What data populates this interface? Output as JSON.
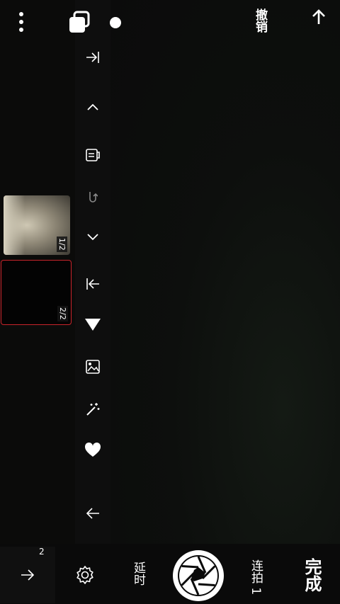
{
  "top": {
    "undo_label": "撤销"
  },
  "thumbnails": [
    {
      "counter": "1/2"
    },
    {
      "counter": "2/2"
    }
  ],
  "bottom": {
    "next_badge": "2",
    "timer_label": "延时",
    "burst_label": "连拍 1",
    "done_label": "完成"
  },
  "colors": {
    "selected_border": "#c8242b",
    "background": "#0b0b0a"
  }
}
